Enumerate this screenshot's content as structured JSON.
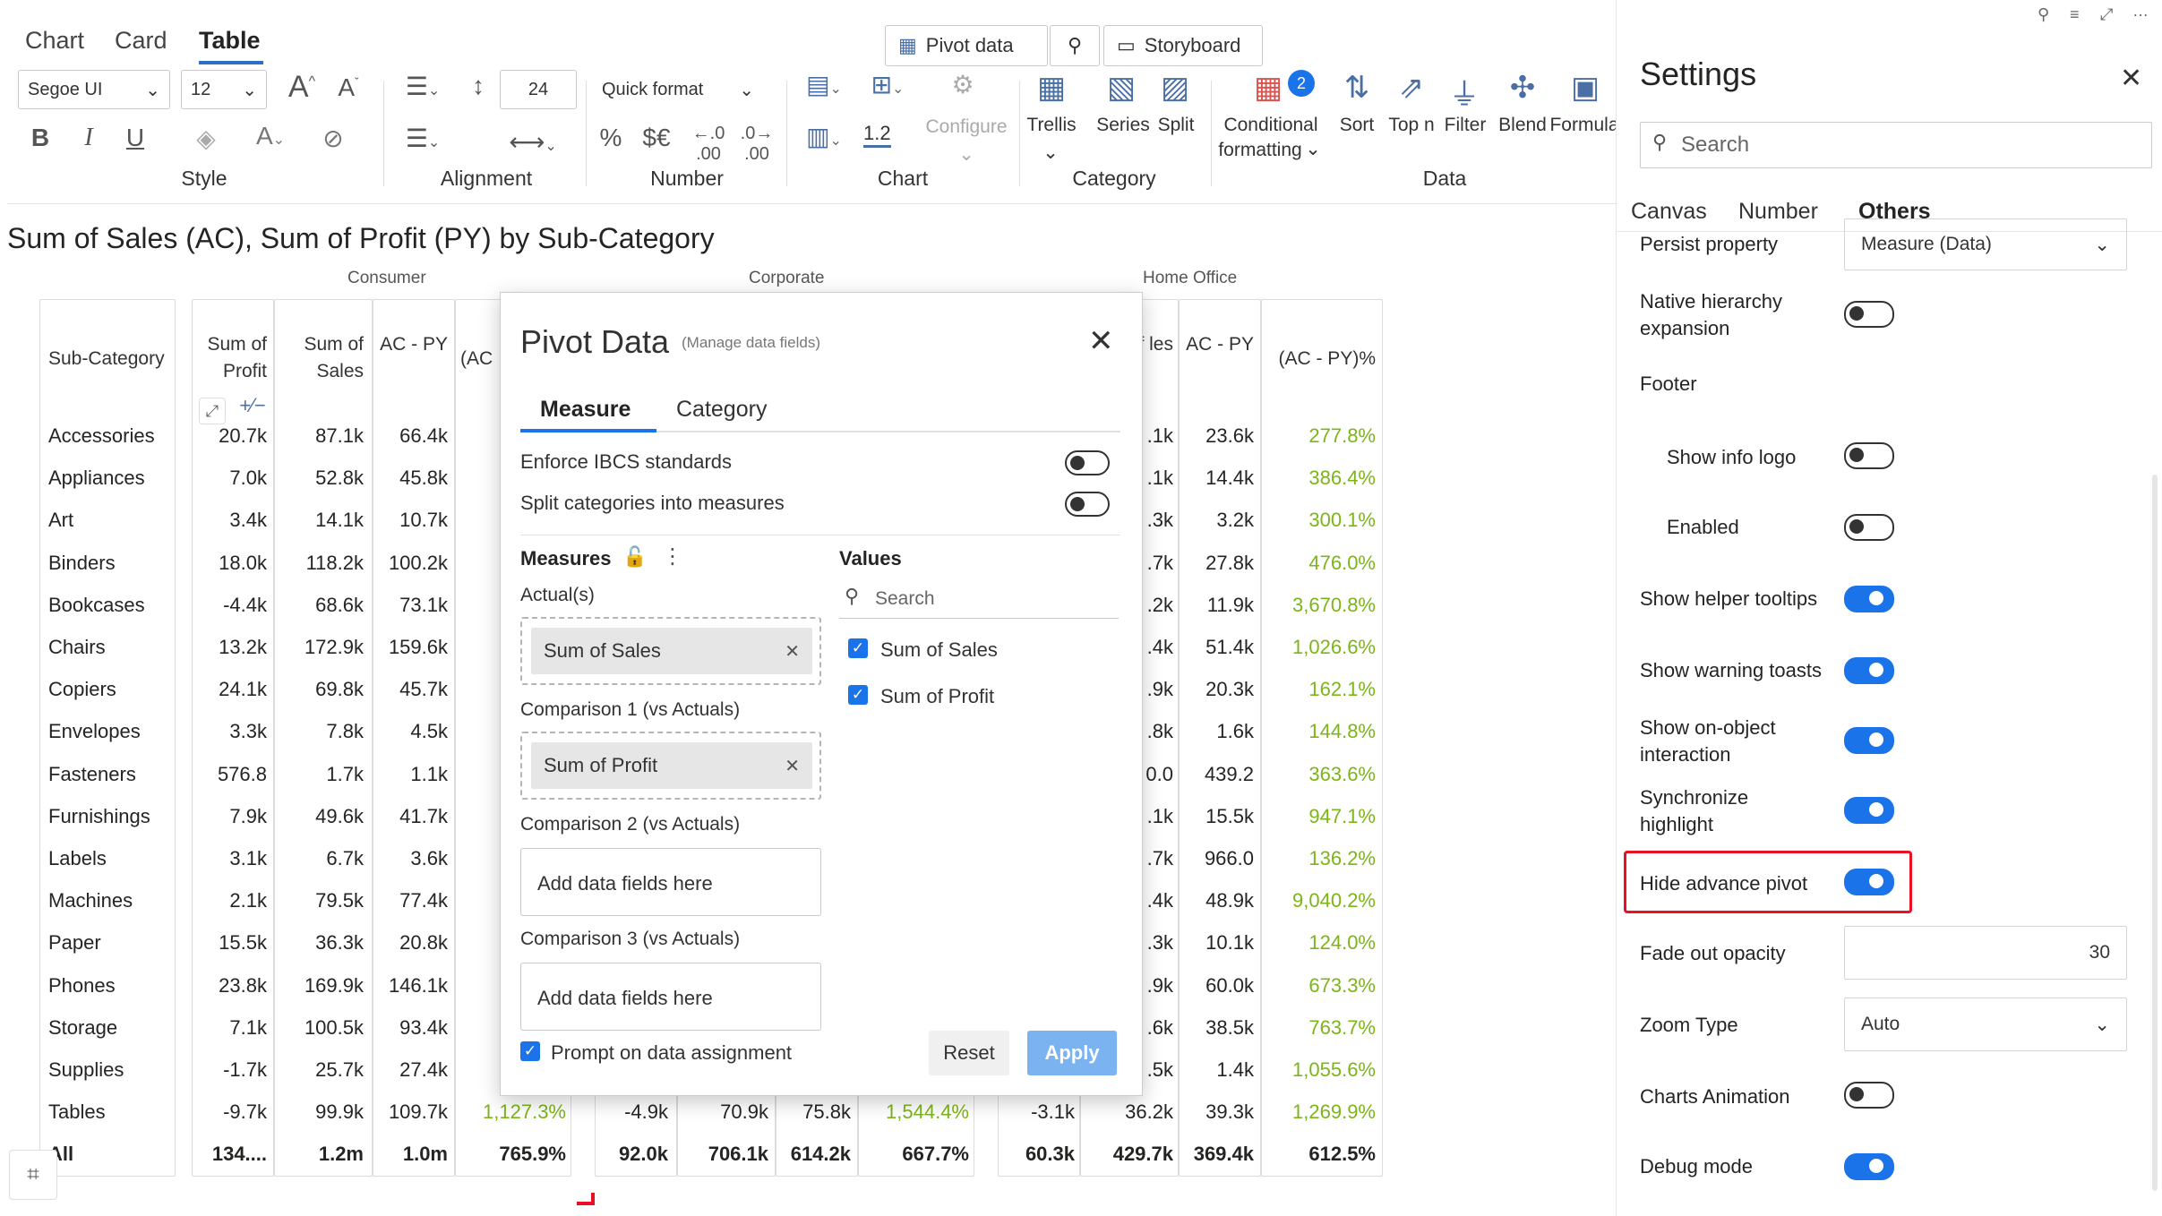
{
  "ribbon": {
    "tabs": [
      "Chart",
      "Card",
      "Table"
    ],
    "pivot_data": "Pivot data",
    "storyboard": "Storyboard",
    "font_family": "Segoe UI",
    "font_size": "12",
    "line_height": "24",
    "quick_format": "Quick format",
    "groups": [
      "Style",
      "Alignment",
      "Number",
      "Chart",
      "Category",
      "Data"
    ],
    "buttons": {
      "configure": "Configure",
      "trellis": "Trellis",
      "series": "Series",
      "split": "Split",
      "conditional": "Conditional",
      "formatting": "formatting",
      "sort": "Sort",
      "topn": "Top n",
      "filter": "Filter",
      "blend": "Blend",
      "formula": "Formula"
    },
    "badge": "2",
    "decimal_value": "1.2"
  },
  "chart": {
    "title": "Sum of Sales (AC), Sum of Profit (PY) by Sub-Category",
    "groups": [
      "Consumer",
      "Corporate",
      "Home Office"
    ],
    "category_header": "Sub-Category",
    "consumer_headers": [
      "Sum of Profit",
      "Sum of Sales",
      "AC - PY",
      "(AC"
    ],
    "home_headers": [
      "n of les",
      "AC - PY",
      "(AC - PY)%"
    ],
    "categories": [
      "Accessories",
      "Appliances",
      "Art",
      "Binders",
      "Bookcases",
      "Chairs",
      "Copiers",
      "Envelopes",
      "Fasteners",
      "Furnishings",
      "Labels",
      "Machines",
      "Paper",
      "Phones",
      "Storage",
      "Supplies",
      "Tables",
      "All"
    ],
    "consumer": [
      [
        "20.7k",
        "87.1k",
        "66.4k",
        ""
      ],
      [
        "7.0k",
        "52.8k",
        "45.8k",
        ""
      ],
      [
        "3.4k",
        "14.1k",
        "10.7k",
        ""
      ],
      [
        "18.0k",
        "118.2k",
        "100.2k",
        ""
      ],
      [
        "-4.4k",
        "68.6k",
        "73.1k",
        "1"
      ],
      [
        "13.2k",
        "172.9k",
        "159.6k",
        "1"
      ],
      [
        "24.1k",
        "69.8k",
        "45.7k",
        ""
      ],
      [
        "3.3k",
        "7.8k",
        "4.5k",
        ""
      ],
      [
        "576.8",
        "1.7k",
        "1.1k",
        ""
      ],
      [
        "7.9k",
        "49.6k",
        "41.7k",
        ""
      ],
      [
        "3.1k",
        "6.7k",
        "3.6k",
        ""
      ],
      [
        "2.1k",
        "79.5k",
        "77.4k",
        "3"
      ],
      [
        "15.5k",
        "36.3k",
        "20.8k",
        ""
      ],
      [
        "23.8k",
        "169.9k",
        "146.1k",
        ""
      ],
      [
        "7.1k",
        "100.5k",
        "93.4k",
        "1"
      ],
      [
        "-1.7k",
        "25.7k",
        "27.4k",
        "1"
      ],
      [
        "-9.7k",
        "99.9k",
        "109.7k",
        "1,127.3%"
      ],
      [
        "134....",
        "1.2m",
        "1.0m",
        "765.9%"
      ]
    ],
    "corporate_visible": [
      [
        "-4.9k",
        "70.9k",
        "75.8k",
        "1,544.4%"
      ],
      [
        "92.0k",
        "706.1k",
        "614.2k",
        "667.7%"
      ]
    ],
    "home": [
      [
        ".1k",
        "23.6k",
        "277.8%"
      ],
      [
        ".1k",
        "14.4k",
        "386.4%"
      ],
      [
        ".3k",
        "3.2k",
        "300.1%"
      ],
      [
        ".7k",
        "27.8k",
        "476.0%"
      ],
      [
        ".2k",
        "11.9k",
        "3,670.8%"
      ],
      [
        ".4k",
        "51.4k",
        "1,026.6%"
      ],
      [
        ".9k",
        "20.3k",
        "162.1%"
      ],
      [
        ".8k",
        "1.6k",
        "144.8%"
      ],
      [
        "0.0",
        "439.2",
        "363.6%"
      ],
      [
        ".1k",
        "15.5k",
        "947.1%"
      ],
      [
        ".7k",
        "966.0",
        "136.2%"
      ],
      [
        ".4k",
        "48.9k",
        "9,040.2%"
      ],
      [
        ".3k",
        "10.1k",
        "124.0%"
      ],
      [
        ".9k",
        "60.0k",
        "673.3%"
      ],
      [
        ".6k",
        "38.5k",
        "763.7%"
      ],
      [
        ".5k",
        "1.4k",
        "1,055.6%"
      ],
      [
        "-3.1k",
        "36.2k",
        "39.3k",
        "1,269.9%"
      ],
      [
        "60.3k",
        "429.7k",
        "369.4k",
        "612.5%"
      ]
    ]
  },
  "dialog": {
    "title": "Pivot Data",
    "subtitle": "(Manage data fields)",
    "tabs": [
      "Measure",
      "Category"
    ],
    "enforce": "Enforce IBCS standards",
    "split": "Split categories into measures",
    "measures": "Measures",
    "values": "Values",
    "actuals": "Actual(s)",
    "actual_field": "Sum of Sales",
    "comp1": "Comparison 1 (vs Actuals)",
    "comp1_field": "Sum of Profit",
    "comp2": "Comparison 2 (vs Actuals)",
    "comp3": "Comparison 3 (vs Actuals)",
    "add_placeholder": "Add data fields here",
    "search": "Search",
    "value_items": [
      "Sum of Sales",
      "Sum of Profit"
    ],
    "prompt": "Prompt on data assignment",
    "reset": "Reset",
    "apply": "Apply"
  },
  "settings": {
    "title": "Settings",
    "search": "Search",
    "tabs": [
      "Canvas",
      "Number",
      "Others"
    ],
    "persist": "Persist property",
    "persist_value": "Measure (Data)",
    "native": "Native hierarchy expansion",
    "footer": "Footer",
    "show_info": "Show info logo",
    "enabled": "Enabled",
    "helper": "Show helper tooltips",
    "warning": "Show warning toasts",
    "onobject": "Show on-object interaction",
    "sync": "Synchronize highlight",
    "hide": "Hide advance pivot",
    "fade": "Fade out opacity",
    "fade_value": "30",
    "zoom": "Zoom Type",
    "zoom_value": "Auto",
    "anim": "Charts Animation",
    "debug": "Debug mode"
  },
  "colors": {
    "accent": "#1a73e8",
    "positive": "#7cb518",
    "highlight": "#e81123"
  }
}
